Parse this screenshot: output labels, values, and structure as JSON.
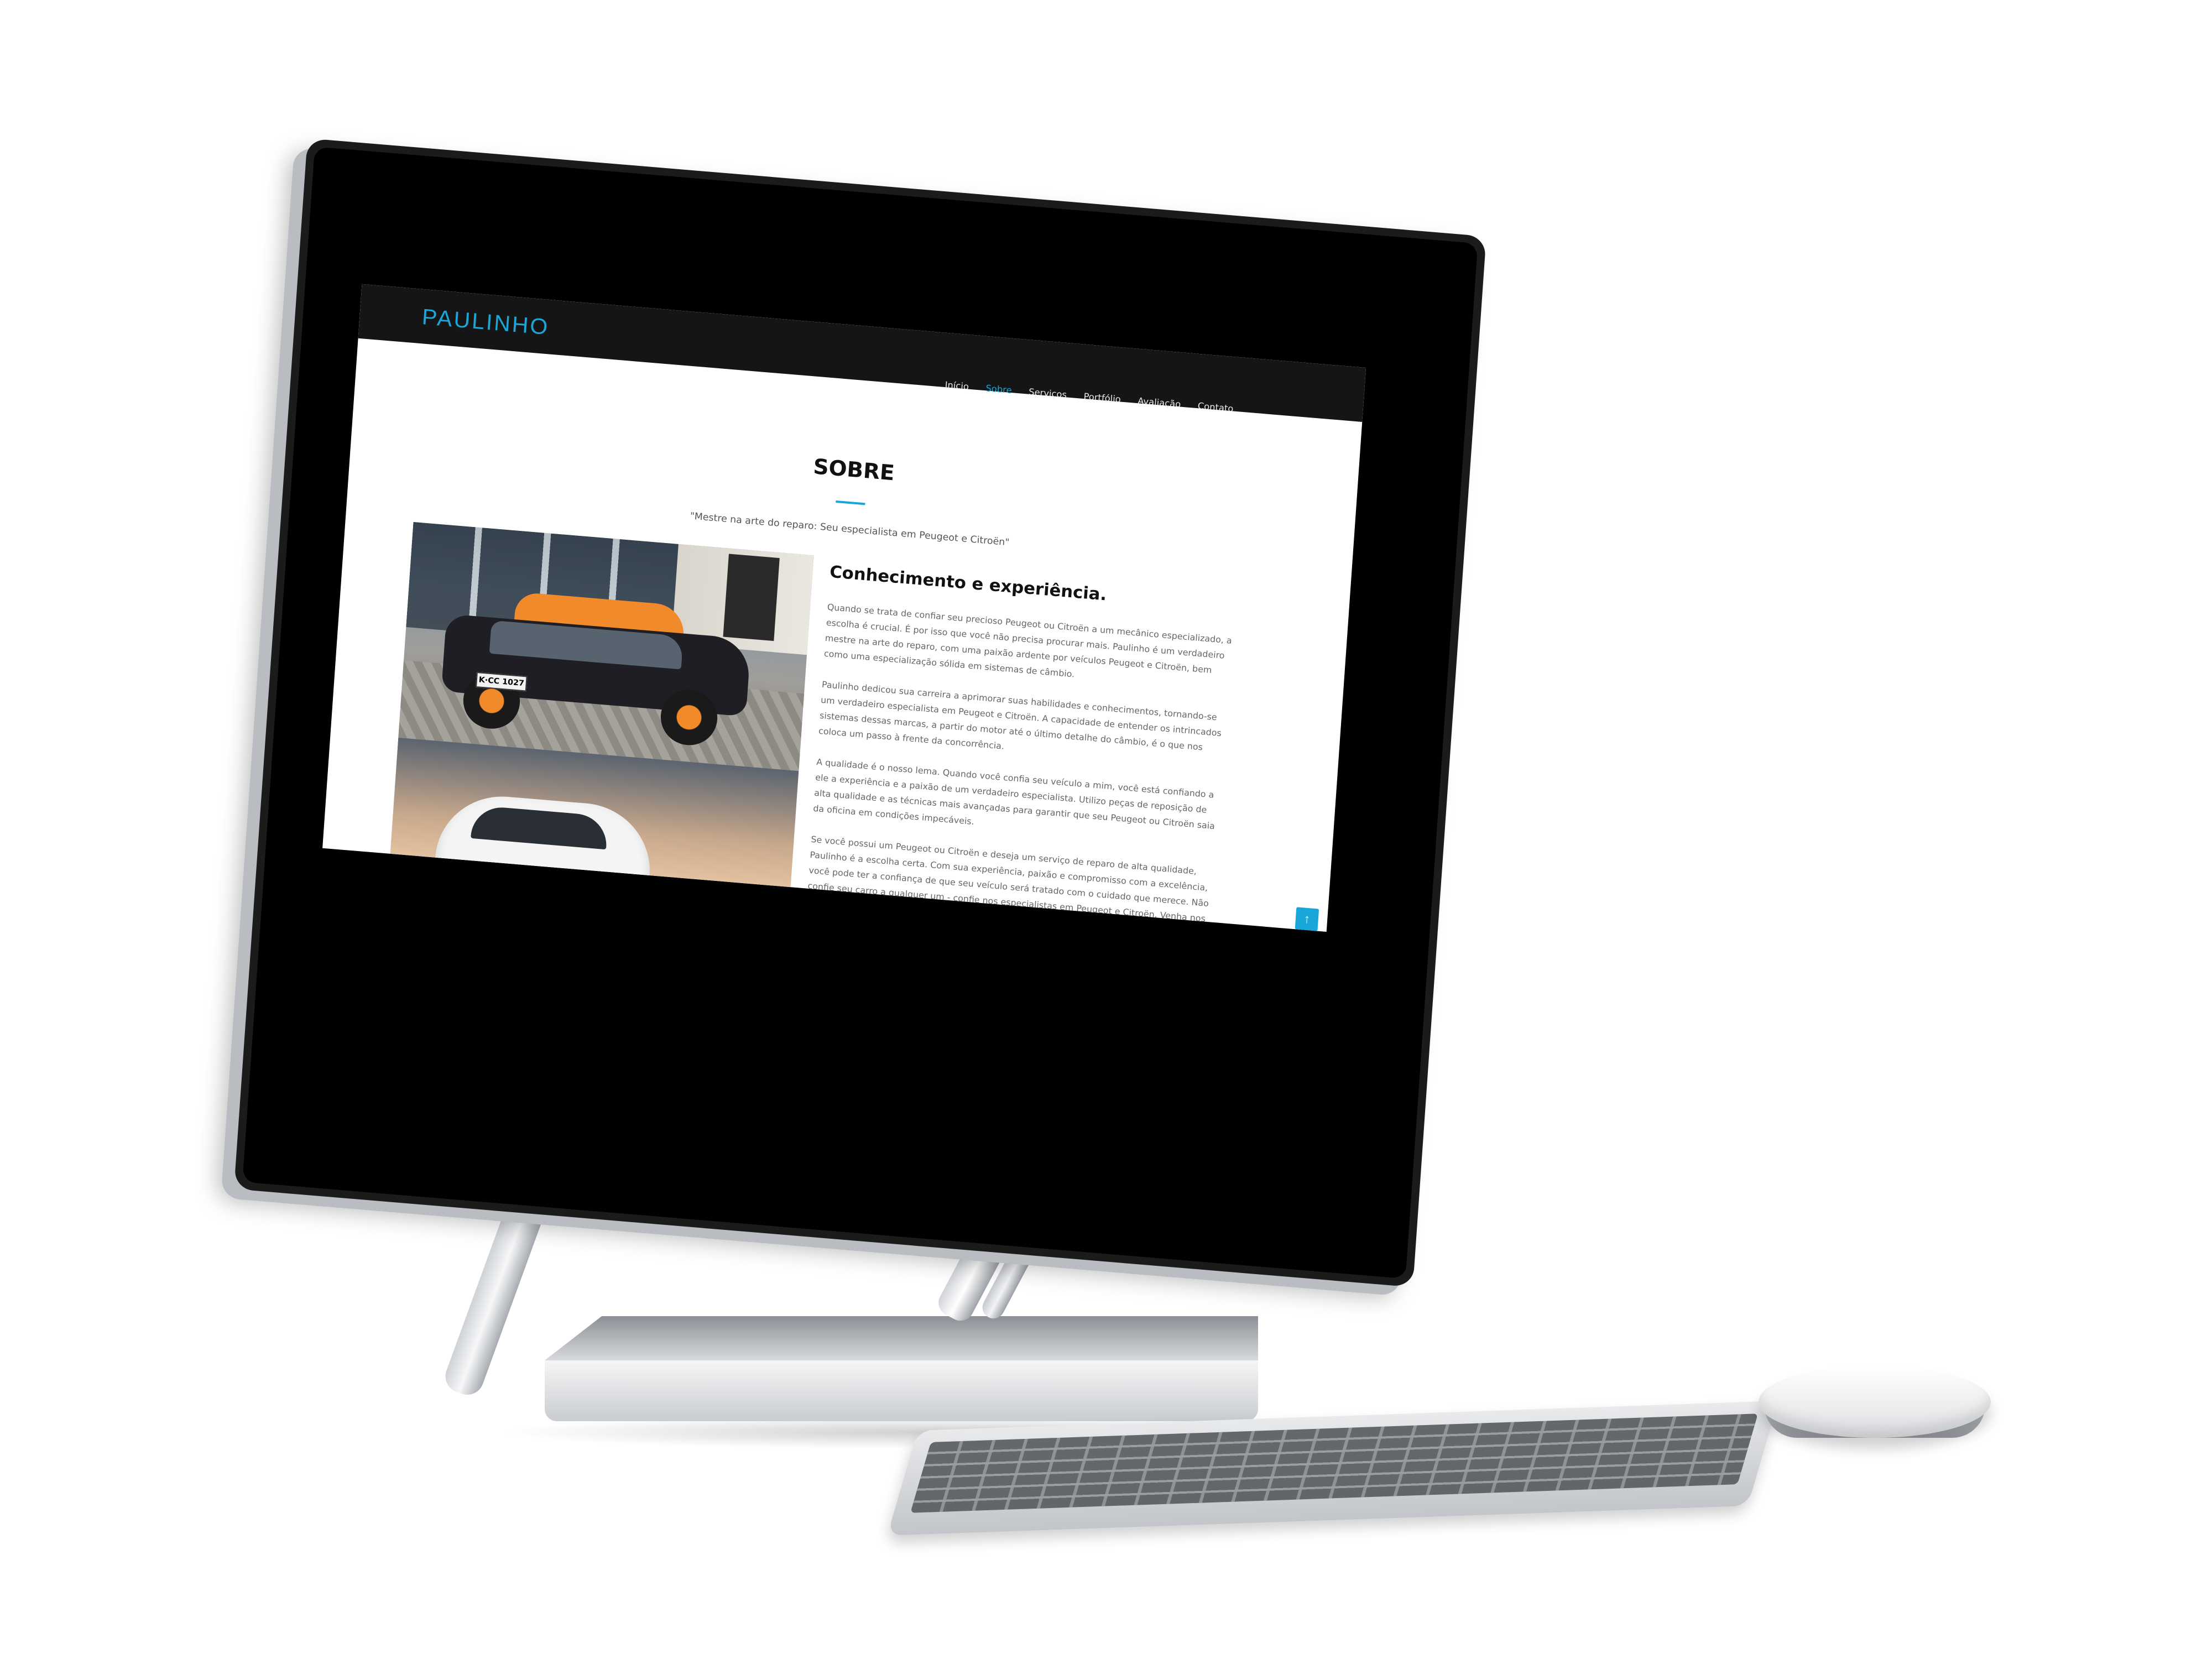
{
  "site": {
    "brand": "PAULINHO",
    "nav": [
      "Início",
      "Sobre",
      "Serviços",
      "Portfólio",
      "Avaliação",
      "Contato"
    ],
    "active_nav": "Sobre",
    "accent_color": "#18a7d8",
    "navbar_color": "#151515"
  },
  "about": {
    "title": "SOBRE",
    "subtitle": "\"Mestre na arte do reparo: Seu especialista em Peugeot e Citroën\"",
    "heading": "Conhecimento e experiência.",
    "paragraphs": [
      "Quando se trata de confiar seu precioso Peugeot ou Citroën a um mecânico especializado, a escolha é crucial. É por isso que você não precisa procurar mais. Paulinho é um verdadeiro mestre na arte do reparo, com uma paixão ardente por veículos Peugeot e Citroën, bem como uma especialização sólida em sistemas de câmbio.",
      "Paulinho dedicou sua carreira a aprimorar suas habilidades e conhecimentos, tornando-se um verdadeiro especialista em Peugeot e Citroën. A capacidade de entender os intrincados sistemas dessas marcas, a partir do motor até o último detalhe do câmbio, é o que nos coloca um passo à frente da concorrência.",
      "A qualidade é o nosso lema. Quando você confia seu veículo a mim, você está confiando a ele a experiência e a paixão de um verdadeiro especialista. Utilizo peças de reposição de alta qualidade e as técnicas mais avançadas para garantir que seu Peugeot ou Citroën saia da oficina em condições impecáveis.",
      "Se você possui um Peugeot ou Citroën e deseja um serviço de reparo de alta qualidade, Paulinho é a escolha certa. Com sua experiência, paixão e compromisso com a excelência, você pode ter a confiança de que seu veículo será tratado com o cuidado que merece. Não confie seu carro a qualquer um - confie nos especialistas em Peugeot e Citroën. Venha nos visitar hoje e experimente a diferença de um verdadeiro mestre na arte do reparo."
    ],
    "plate_text": "K·CC 1027"
  },
  "icons": {
    "scroll_top": "arrow-up-icon"
  }
}
